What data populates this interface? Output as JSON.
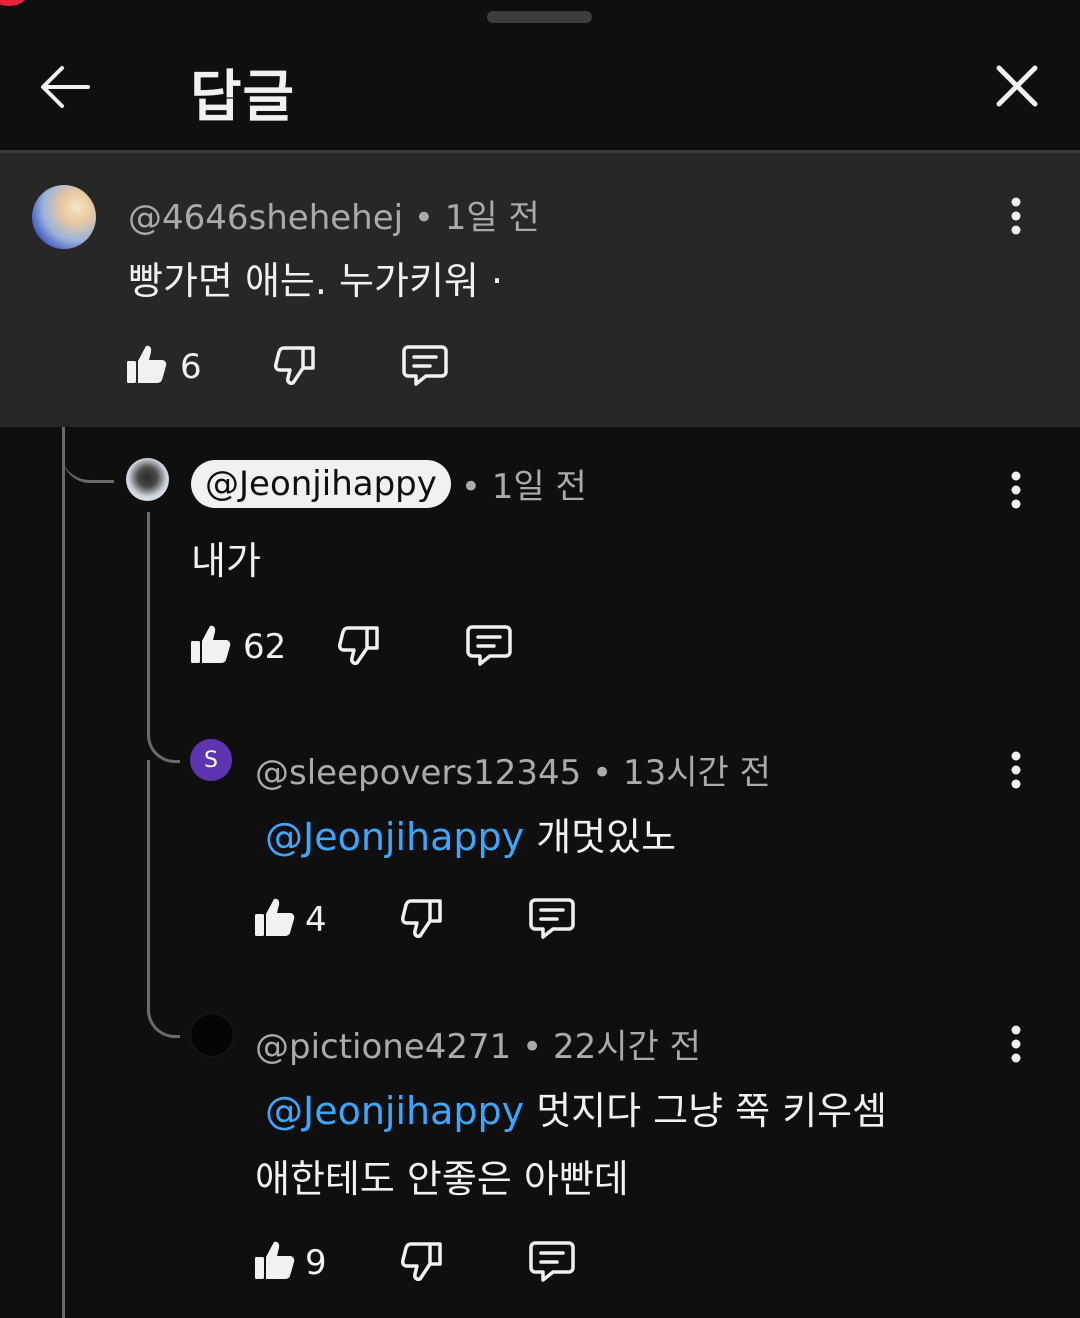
{
  "header": {
    "title": "답글"
  },
  "comments": [
    {
      "author": "@4646shehehej",
      "time": "• 1일 전",
      "text": "빵가면 애는. 누가키워 ·",
      "likes": "6"
    },
    {
      "author": "@Jeonjihappy",
      "time": "• 1일 전",
      "text": "내가",
      "likes": "62"
    },
    {
      "author": "@sleepovers12345",
      "time": "• 13시간 전",
      "mention": "@Jeonjihappy",
      "text": " 개멋있노",
      "likes": "4",
      "avatar_letter": "S",
      "avatar_color": "#5e35b1"
    },
    {
      "author": "@pictione4271",
      "time": "• 22시간 전",
      "mention": "@Jeonjihappy",
      "text": " 멋지다 그냥 쭉 키우셈",
      "text2": "애한테도 안좋은 아빤데",
      "likes": "9"
    }
  ],
  "colors": {
    "background": "#0f0f0f",
    "highlight": "#272727",
    "mention": "#3ea6ff",
    "secondary_text": "#aaaaaa"
  },
  "icons": [
    "back-arrow-icon",
    "close-icon",
    "like-icon",
    "dislike-icon",
    "reply-icon",
    "more-vert-icon"
  ]
}
